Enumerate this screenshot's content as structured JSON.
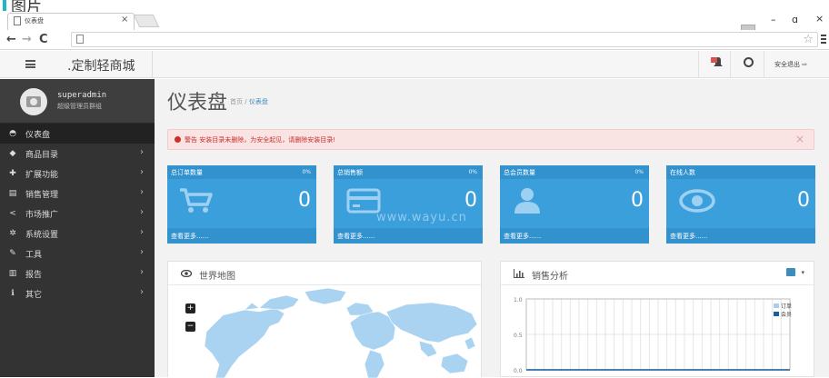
{
  "caption": "图片",
  "browser": {
    "tab_title": "仪表盘",
    "tab_close": "×",
    "back": "←",
    "forward": "→",
    "reload": "C",
    "star": "☆",
    "win_min": "–",
    "win_max": "ɑ",
    "win_close": "×"
  },
  "header": {
    "brand": ".定制轻商城",
    "logout": "安全退出"
  },
  "sidebar": {
    "username": "superadmin",
    "role": "超级管理员群组",
    "items": [
      {
        "label": "仪表盘",
        "icon": "dashboard-icon",
        "glyph": "◓",
        "active": true,
        "chevron": ""
      },
      {
        "label": "商品目录",
        "icon": "tag-icon",
        "glyph": "◆",
        "active": false,
        "chevron": "›"
      },
      {
        "label": "扩展功能",
        "icon": "puzzle-icon",
        "glyph": "✚",
        "active": false,
        "chevron": "›"
      },
      {
        "label": "销售管理",
        "icon": "cart-icon",
        "glyph": "▤",
        "active": false,
        "chevron": "›"
      },
      {
        "label": "市场推广",
        "icon": "share-icon",
        "glyph": "<",
        "active": false,
        "chevron": "›"
      },
      {
        "label": "系统设置",
        "icon": "cog-icon",
        "glyph": "✲",
        "active": false,
        "chevron": "›"
      },
      {
        "label": "工具",
        "icon": "wrench-icon",
        "glyph": "✎",
        "active": false,
        "chevron": "›"
      },
      {
        "label": "报告",
        "icon": "bar-chart-icon",
        "glyph": "▥",
        "active": false,
        "chevron": "›"
      },
      {
        "label": "其它",
        "icon": "other-icon",
        "glyph": "ℹ",
        "active": false,
        "chevron": "›"
      }
    ]
  },
  "main": {
    "title": "仪表盘",
    "breadcrumb_home": "首页",
    "breadcrumb_sep": "/",
    "breadcrumb_current": "仪表盘",
    "alert": "警告 安装目录未删除，为安全起见，请删除安装目录!",
    "alert_close": "×",
    "watermark": "www.wayu.cn",
    "stats": [
      {
        "label": "总订单数量",
        "percent": "0%",
        "value": "0",
        "more": "查看更多......",
        "icon": "cart-icon"
      },
      {
        "label": "总销售额",
        "percent": "0%",
        "value": "0",
        "more": "查看更多......",
        "icon": "credit-card-icon"
      },
      {
        "label": "总会员数量",
        "percent": "0%",
        "value": "0",
        "more": "查看更多......",
        "icon": "user-icon"
      },
      {
        "label": "在线人数",
        "percent": "",
        "value": "0",
        "more": "查看更多......",
        "icon": "eye-icon"
      }
    ],
    "map_panel": {
      "title": "世界地图",
      "zoom_in": "+",
      "zoom_out": "−"
    },
    "sales_panel": {
      "title": "销售分析",
      "caret": "▾"
    }
  },
  "colors": {
    "stat_bg": "#3b9fdb",
    "sidebar_bg": "#333333",
    "alert_text": "#c9302c",
    "map_land": "#a9d3f0",
    "series_order": "#a9cfee",
    "series_member": "#1e5c9c"
  },
  "chart_data": {
    "type": "line",
    "title": "",
    "xlabel": "",
    "ylabel": "",
    "ylim": [
      0.0,
      1.0
    ],
    "y_ticks": [
      "1.0",
      "0.5",
      "0.0"
    ],
    "grid": true,
    "legend_position": "top-right",
    "series": [
      {
        "name": "订单",
        "values": [
          0,
          0,
          0,
          0,
          0,
          0,
          0,
          0,
          0,
          0,
          0,
          0,
          0,
          0,
          0,
          0,
          0,
          0,
          0,
          0,
          0,
          0,
          0,
          0,
          0,
          0,
          0,
          0,
          0,
          0,
          0
        ]
      },
      {
        "name": "会员",
        "values": [
          0,
          0,
          0,
          0,
          0,
          0,
          0,
          0,
          0,
          0,
          0,
          0,
          0,
          0,
          0,
          0,
          0,
          0,
          0,
          0,
          0,
          0,
          0,
          0,
          0,
          0,
          0,
          0,
          0,
          0,
          0
        ]
      }
    ]
  }
}
